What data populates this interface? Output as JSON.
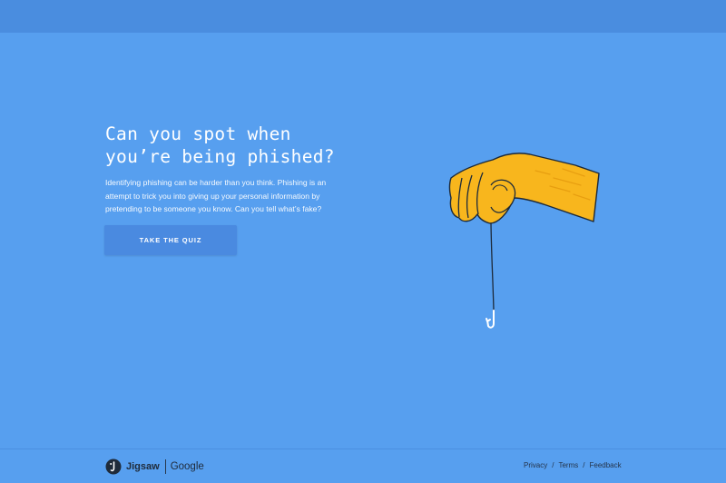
{
  "colors": {
    "background": "#579fef",
    "topbar": "#4a8ddf",
    "button": "#4a8ae0",
    "hand": "#f8b61d",
    "text": "#ffffff",
    "footer_text": "#25344a"
  },
  "hero": {
    "title_line1": "Can you spot when",
    "title_line2": "you’re being phished?",
    "description": "Identifying phishing can be harder than you think. Phishing is an attempt to trick you into giving up your personal information by pretending to be someone you know. Can you tell what’s fake?",
    "cta_label": "TAKE THE QUIZ"
  },
  "footer": {
    "brand_jigsaw": "Jigsaw",
    "brand_google": "Google",
    "links": [
      "Privacy",
      "Terms",
      "Feedback"
    ],
    "separator": "/"
  },
  "icons": {
    "logo": "jigsaw-logo-icon",
    "illustration": "hand-holding-fishhook-illustration"
  }
}
